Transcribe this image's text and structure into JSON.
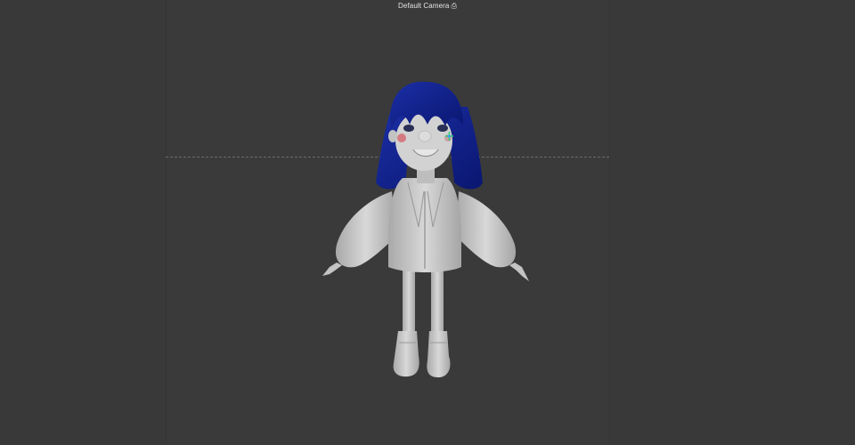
{
  "viewport": {
    "camera_label": "Default Camera",
    "camera_icon": "camera-icon",
    "colors": {
      "background": "#3a3a3a",
      "model_body": "#c9c9c9",
      "hair": "#10218a",
      "cheek": "#d47a80"
    }
  }
}
